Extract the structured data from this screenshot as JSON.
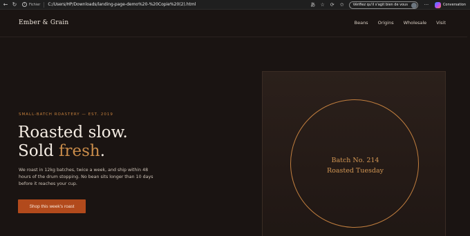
{
  "browser": {
    "site_label": "Fichier",
    "url": "C:/Users/HP/Downloads/landing-page-demo%20-%20Copie%20(2).html",
    "verify_label": "Vérifiez qu'il s'agit bien de vous",
    "copilot_label": "Conversation",
    "more_label": "···"
  },
  "header": {
    "brand": "Ember & Grain",
    "nav": [
      "Beans",
      "Origins",
      "Wholesale",
      "Visit"
    ]
  },
  "hero": {
    "eyebrow": "SMALL-BATCH ROASTERY — EST. 2019",
    "title_line1": "Roasted slow.",
    "title_line2_prefix": "Sold ",
    "title_line2_accent": "fresh",
    "title_line2_suffix": ".",
    "body": "We roast in 12kg batches, twice a week, and ship within 48 hours of the drum stopping. No bean sits longer than 10 days before it reaches your cup.",
    "cta_label": "Shop this week's roast"
  },
  "batch": {
    "line1": "Batch No. 214",
    "line2": "Roasted Tuesday"
  },
  "colors": {
    "background": "#1a1412",
    "accent": "#c98c4a",
    "cta": "#b24a1c"
  }
}
